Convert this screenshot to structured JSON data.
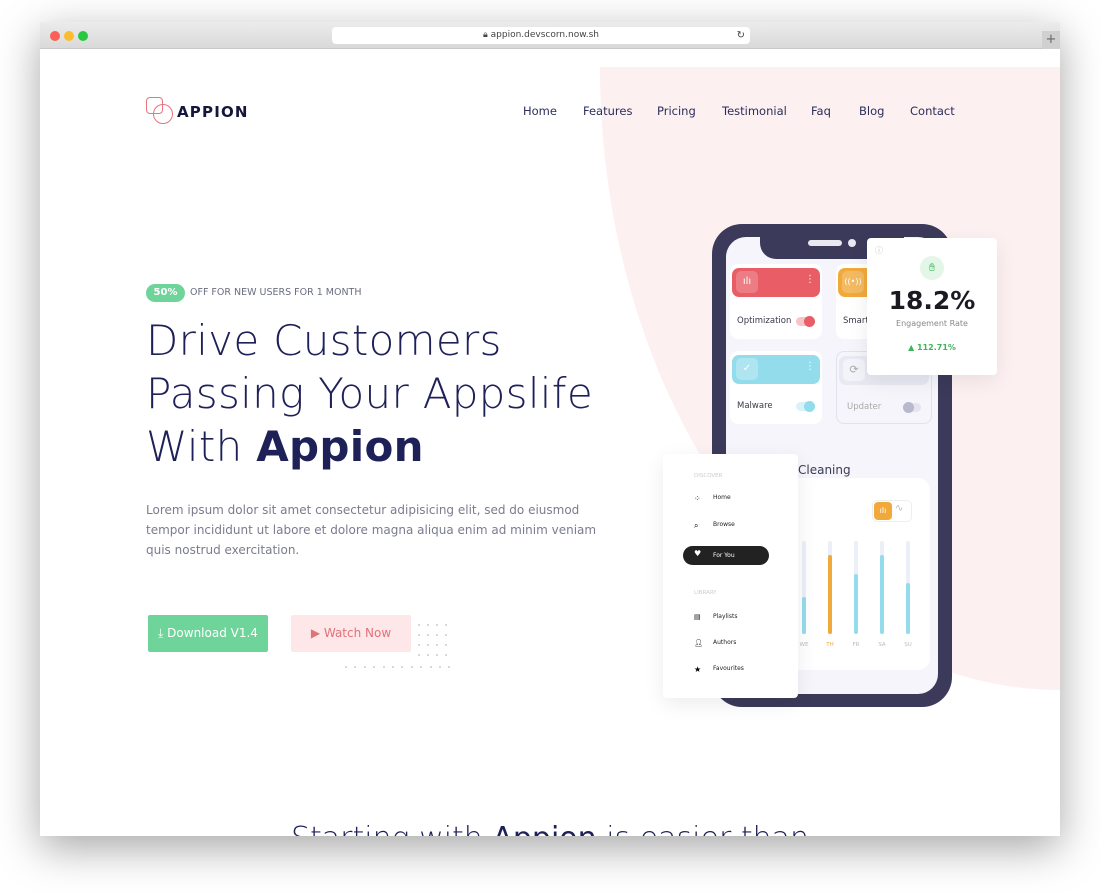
{
  "browser": {
    "url": "appion.devscorn.now.sh"
  },
  "brand": {
    "name": "APPION",
    "accent": "#e8747c"
  },
  "nav": [
    "Home",
    "Features",
    "Pricing",
    "Testimonial",
    "Faq",
    "Blog",
    "Contact"
  ],
  "hero": {
    "badge": "50%",
    "badge_text": "OFF FOR NEW USERS FOR 1 MONTH",
    "title_l1": "Drive Customers",
    "title_l2": "Passing Your Appslife",
    "title_l3": "With ",
    "title_bold": "Appion",
    "desc": "Lorem ipsum dolor sit amet consectetur adipisicing elit, sed do eiusmod tempor incididunt ut labore et dolore magna aliqua enim ad minim veniam quis nostrud exercitation.",
    "download": "Download V1.4",
    "watch": "Watch Now"
  },
  "phone": {
    "cards": [
      "Optimization",
      "Smart",
      "Malware",
      "Updater"
    ],
    "section": "Cleaning",
    "chart": {
      "days": [
        "WE",
        "TH",
        "FR",
        "SA",
        "SU"
      ],
      "levels": [
        0.4,
        0.85,
        0.65,
        0.85,
        0.55
      ],
      "highlight": "TH"
    }
  },
  "engagement": {
    "value": "18.2%",
    "label": "Engagement Rate",
    "change": "112.71%"
  },
  "menu": {
    "discover": "DISCOVER",
    "items": [
      "Home",
      "Browse",
      "For You"
    ],
    "library": "LIBRARY",
    "lib_items": [
      "Playlists",
      "Authors",
      "Favourites"
    ]
  },
  "next_section": {
    "title_pre": "Starting with ",
    "title_bold": "Appion",
    "title_post": " is easier than"
  },
  "colors": {
    "green": "#6fd49a",
    "red": "#e85d66",
    "orange": "#f2a93b",
    "blue": "#93dcec",
    "navy": "#1e2158"
  }
}
